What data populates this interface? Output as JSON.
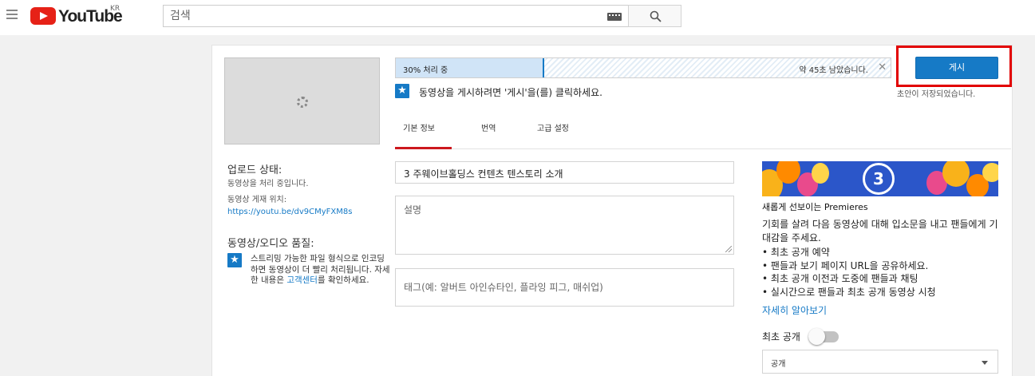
{
  "header": {
    "logo_text": "YouTube",
    "logo_region": "KR",
    "search_placeholder": "검색"
  },
  "upload": {
    "progress_label": "30% 처리 중",
    "progress_percent": 30,
    "time_remaining": "약 45초 남았습니다.",
    "publish_button": "게시",
    "draft_saved": "초안이 저장되었습니다.",
    "publish_hint": "동영상을 게시하려면 '게시'을(를) 클릭하세요."
  },
  "sidebar": {
    "status_heading": "업로드 상태:",
    "status_text": "동영상을 처리 중입니다.",
    "location_label": "동영상 게재 위치:",
    "video_url": "https://youtu.be/dv9CMyFXM8s",
    "quality_heading": "동영상/오디오 품질:",
    "quality_note_1": "스트리밍 가능한 파일 형식으로 인코딩하면 동영상이 더 빨리 처리됩니다. 자세한 내용은 ",
    "quality_note_link": "고객센터",
    "quality_note_2": "를 확인하세요."
  },
  "tabs": [
    {
      "label": "기본 정보",
      "active": true
    },
    {
      "label": "번역",
      "active": false
    },
    {
      "label": "고급 설정",
      "active": false
    }
  ],
  "form": {
    "title_value": "3 주웨이브홀딩스 컨텐츠 텐스토리 소개",
    "description_placeholder": "설명",
    "tags_placeholder": "태그(예: 알버트 아인슈타인, 플라잉 피그, 매쉬업)"
  },
  "premieres": {
    "banner_number": "3",
    "title": "새롭게 선보이는 Premieres",
    "description": "기회를 살려 다음 동영상에 대해 입소문을 내고 팬들에게 기대감을 주세요.",
    "bullets": [
      "최초 공개 예약",
      "팬들과 보기 페이지 URL을 공유하세요.",
      "최초 공개 이전과 도중에 팬들과 채팅",
      "실시간으로 팬들과 최초 공개 동영상 시청"
    ],
    "learn_more": "자세히 알아보기",
    "toggle_label": "최초 공개",
    "toggle_on": false,
    "visibility_value": "공개"
  },
  "colors": {
    "brand_red": "#e62117",
    "accent_blue": "#167ac6",
    "highlight_frame": "#e20000"
  }
}
